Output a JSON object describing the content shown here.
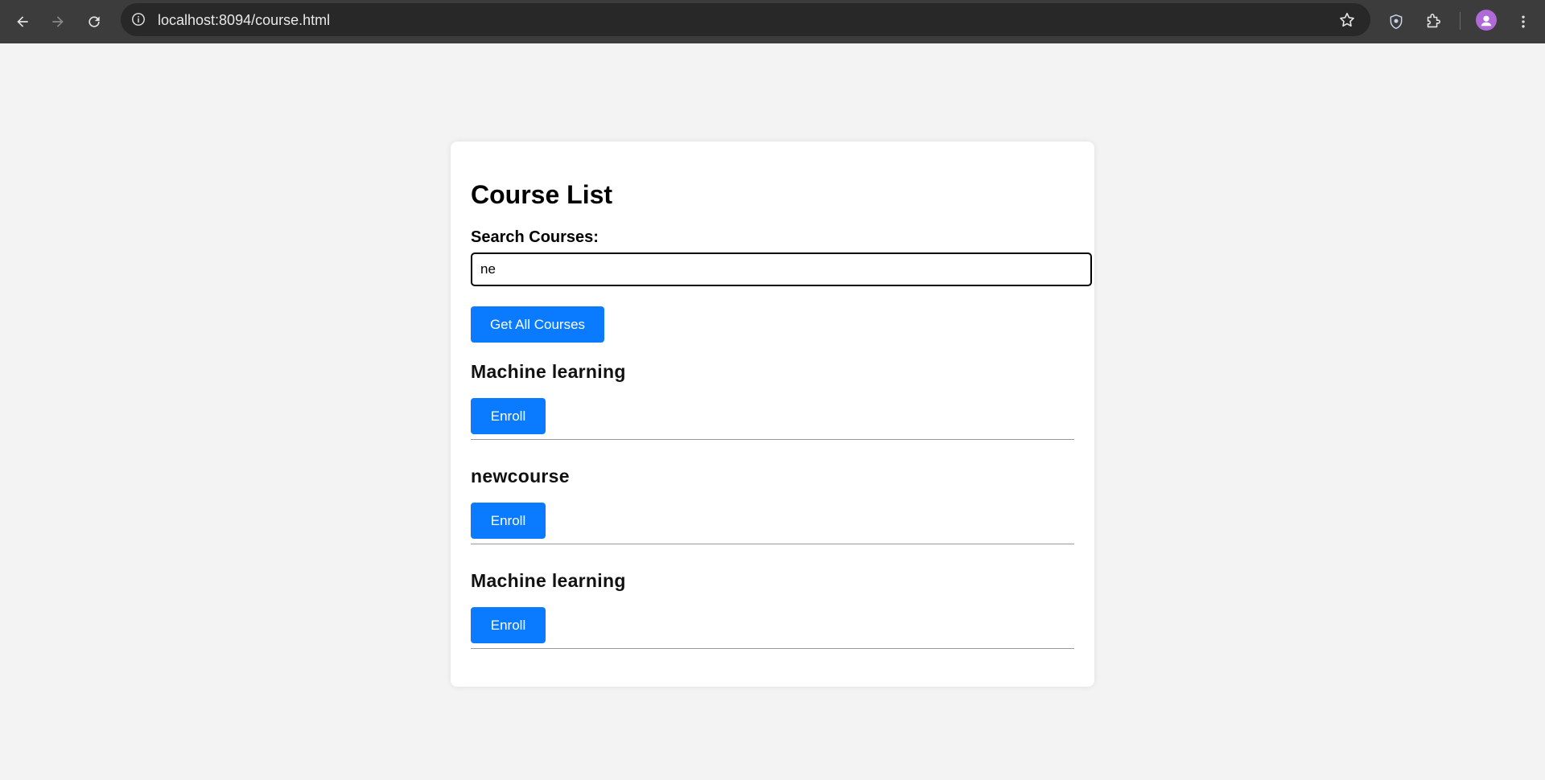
{
  "browser": {
    "url": "localhost:8094/course.html"
  },
  "page": {
    "title": "Course List",
    "search_label": "Search Courses:",
    "search_value": "ne",
    "get_all_label": "Get All Courses"
  },
  "courses": [
    {
      "name": "Machine learning",
      "enroll_label": "Enroll"
    },
    {
      "name": "newcourse",
      "enroll_label": "Enroll"
    },
    {
      "name": "Machine learning",
      "enroll_label": "Enroll"
    }
  ],
  "colors": {
    "accent": "#0a7bff",
    "page_bg": "#f3f3f3",
    "chrome_bg": "#3c3c3c"
  }
}
